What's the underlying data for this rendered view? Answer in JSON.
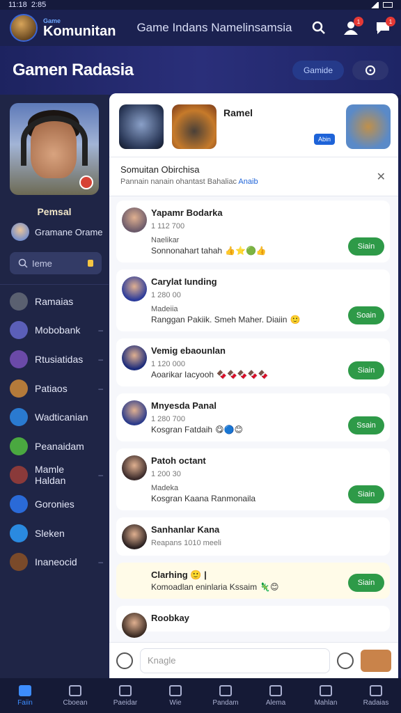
{
  "status": {
    "time": "11:18",
    "extra": "2:85"
  },
  "header": {
    "brand_small": "Game",
    "brand_name": "Komunitan",
    "subtitle": "Game Indans Namelinsamsia",
    "badge_user": "1",
    "badge_chat": "1"
  },
  "banner": {
    "title": "Gamen Radasia",
    "button": "Gamide"
  },
  "sidebar": {
    "profile_name": "Pemsal",
    "group_name": "Gramane Orame",
    "search_placeholder": "Ieme",
    "items": [
      {
        "label": "Ramaias",
        "icon": "gamepad-icon",
        "color": "#5a6070"
      },
      {
        "label": "Mobobank",
        "icon": "shield-icon",
        "color": "#5b5fb8"
      },
      {
        "label": "Rtusiatidas",
        "icon": "sword-icon",
        "color": "#6b4aa8"
      },
      {
        "label": "Patiaos",
        "icon": "helmet-icon",
        "color": "#b47a3a"
      },
      {
        "label": "Wadticanian",
        "icon": "trophy-icon",
        "color": "#2a7ad0"
      },
      {
        "label": "Peanaidam",
        "icon": "leaf-icon",
        "color": "#4aa840"
      },
      {
        "label": "Mamle Haldan",
        "icon": "character-icon",
        "color": "#8a3a3a"
      },
      {
        "label": "Goronies",
        "icon": "globe-icon",
        "color": "#2a6ad8"
      },
      {
        "label": "Sleken",
        "icon": "bird-icon",
        "color": "#2a8ae0"
      },
      {
        "label": "Inaneocid",
        "icon": "warrior-icon",
        "color": "#7a4a2a"
      }
    ]
  },
  "main": {
    "game_title": "Ramel",
    "game_tag": "Abin",
    "notice_title": "Somuitan Obirchisa",
    "notice_sub": "Pannain nanain ohantast Bahaliac",
    "notice_link": "Anaib",
    "posts": [
      {
        "name": "Yapamr Bodarka",
        "time": "1 112 700",
        "meta": "Naelikar",
        "text": "Sonnonahart tahah",
        "emoji": "👍⭐🟢👍",
        "join": "Siain",
        "avatar": "#6b5a6a"
      },
      {
        "name": "Carylat Iunding",
        "time": "1 280 00",
        "meta": "Madeiia",
        "text": "Ranggan Pakiik. Smeh Maher. Diaiin",
        "emoji": "🙂",
        "join": "Soain",
        "avatar": "#2a3a9a"
      },
      {
        "name": "Vemig ebaounlan",
        "time": "1 120 000",
        "meta": "",
        "text": "Aoarikar Iacyooh",
        "emoji": "🍫🍫🍫🍫🍫",
        "join": "Siain",
        "avatar": "#1a2a7a"
      },
      {
        "name": "Mnyesda Panal",
        "time": "1 280 700",
        "meta": "",
        "text": "Kosgran Fatdaih",
        "emoji": "😋🔵😊",
        "join": "Ssain",
        "avatar": "#2a3a8a"
      },
      {
        "name": "Patoh octant",
        "time": "1 200 30",
        "meta": "Madeka",
        "text": "Kosgran Kaana Ranmonaila",
        "emoji": "",
        "join": "Siain",
        "avatar": "#3a2a2a"
      },
      {
        "name": "Sanhanlar Kana",
        "time": "Reapans 1010 meeli",
        "meta": "",
        "text": "",
        "emoji": "",
        "join": "",
        "avatar": "#2a2020"
      },
      {
        "name": "Clarhing 🙂 |",
        "time": "",
        "meta": "",
        "text": "Komoadlan eninlaria Kssaim",
        "emoji": "🦎😊",
        "join": "Siain",
        "avatar": "",
        "highlight": true
      },
      {
        "name": "Roobkay",
        "time": "",
        "meta": "",
        "text": "",
        "emoji": "",
        "join": "",
        "avatar": "#3a2a22"
      }
    ],
    "composer_placeholder": "Knagle"
  },
  "nav": [
    {
      "label": "Faiin",
      "active": true
    },
    {
      "label": "Cboean"
    },
    {
      "label": "Paeidar"
    },
    {
      "label": "Wie"
    },
    {
      "label": "Pandam"
    },
    {
      "label": "Alema"
    },
    {
      "label": "Mahlan"
    },
    {
      "label": "Radaias"
    }
  ]
}
